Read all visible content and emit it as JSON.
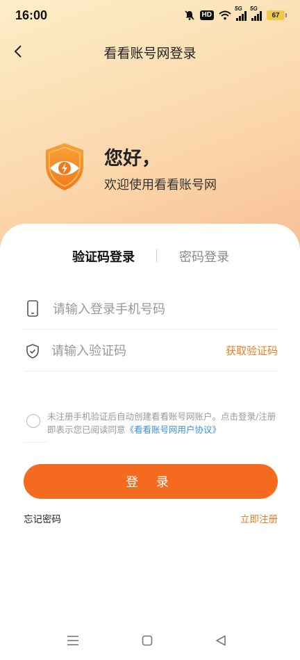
{
  "status_bar": {
    "time": "16:00",
    "hd": "HD",
    "signal_1": "5G",
    "signal_2": "5G",
    "battery": "67"
  },
  "nav": {
    "title": "看看账号网登录"
  },
  "welcome": {
    "greeting": "您好，",
    "subtitle": "欢迎使用看看账号网"
  },
  "tabs": {
    "sms_login": "验证码登录",
    "password_login": "密码登录"
  },
  "form": {
    "phone_placeholder": "请输入登录手机号码",
    "code_placeholder": "请输入验证码",
    "get_code": "获取验证码"
  },
  "agreement": {
    "text": "未注册手机验证后自动创建看看账号网账户。点击登录/注册即表示您已阅读同意",
    "link": "《看看账号网用户协议》"
  },
  "login_button": "登 录",
  "links": {
    "forgot": "忘记密码",
    "register": "立即注册"
  },
  "colors": {
    "accent": "#f46a1e",
    "link_orange": "#e67e22",
    "link_blue": "#3a8fd8"
  }
}
